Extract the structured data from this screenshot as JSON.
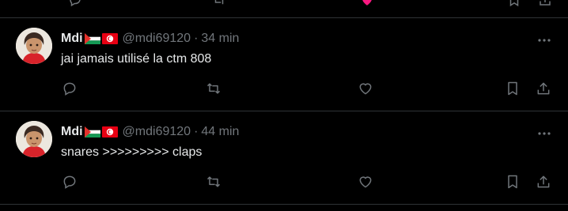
{
  "colors": {
    "background": "#000000",
    "text_primary": "#e7e9ea",
    "text_secondary": "#71767b",
    "divider": "#2f3336",
    "like_active": "#f91880"
  },
  "posts": [
    {
      "author_name": "Mdi",
      "flags": [
        "palestine-flag",
        "tunisia-flag"
      ],
      "handle": "@mdi69120",
      "separator": "·",
      "time": "34 min",
      "text": "jai jamais utilisé la ctm 808"
    },
    {
      "author_name": "Mdi",
      "flags": [
        "palestine-flag",
        "tunisia-flag"
      ],
      "handle": "@mdi69120",
      "separator": "·",
      "time": "44 min",
      "text": "snares >>>>>>>>> claps"
    }
  ],
  "actions": [
    "reply-icon",
    "repost-icon",
    "like-icon",
    "bookmark-icon",
    "share-icon"
  ]
}
